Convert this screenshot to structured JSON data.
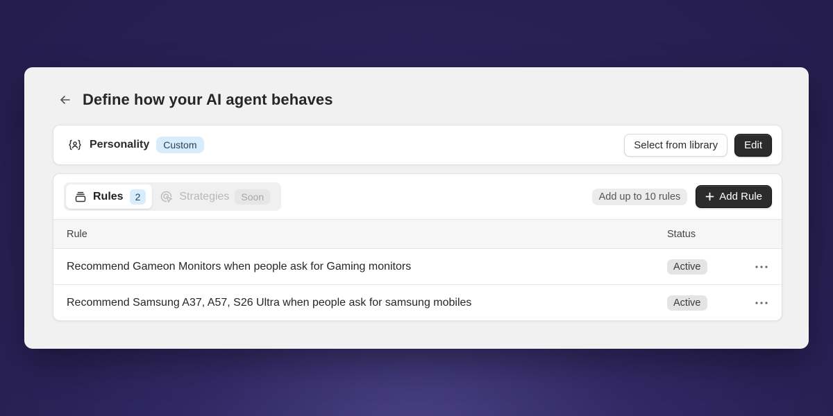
{
  "page": {
    "title": "Define how your AI agent behaves",
    "back_icon": "arrow-left-icon"
  },
  "personality": {
    "icon": "person-braces-icon",
    "label": "Personality",
    "badge": "Custom",
    "select_button": "Select from library",
    "edit_button": "Edit"
  },
  "tabs": [
    {
      "icon": "stack-icon",
      "label": "Rules",
      "count": "2",
      "active": true
    },
    {
      "icon": "cursor-target-icon",
      "label": "Strategies",
      "badge": "Soon",
      "disabled": true
    }
  ],
  "rules_toolbar": {
    "limit_note": "Add up to 10 rules",
    "add_button": "Add Rule",
    "add_icon": "plus-icon"
  },
  "table": {
    "columns": [
      "Rule",
      "Status"
    ],
    "rows": [
      {
        "rule": "Recommend Gameon Monitors when people ask for Gaming monitors",
        "status": "Active"
      },
      {
        "rule": "Recommend Samsung A37, A57, S26 Ultra when people ask for samsung mobiles",
        "status": "Active"
      }
    ],
    "row_menu_icon": "more-horizontal-icon"
  },
  "colors": {
    "background": "#2a2258",
    "panel": "#f1f1f1",
    "card": "#ffffff",
    "badge_blue": "#d9ecfb",
    "dark_button": "#2b2b2b"
  }
}
